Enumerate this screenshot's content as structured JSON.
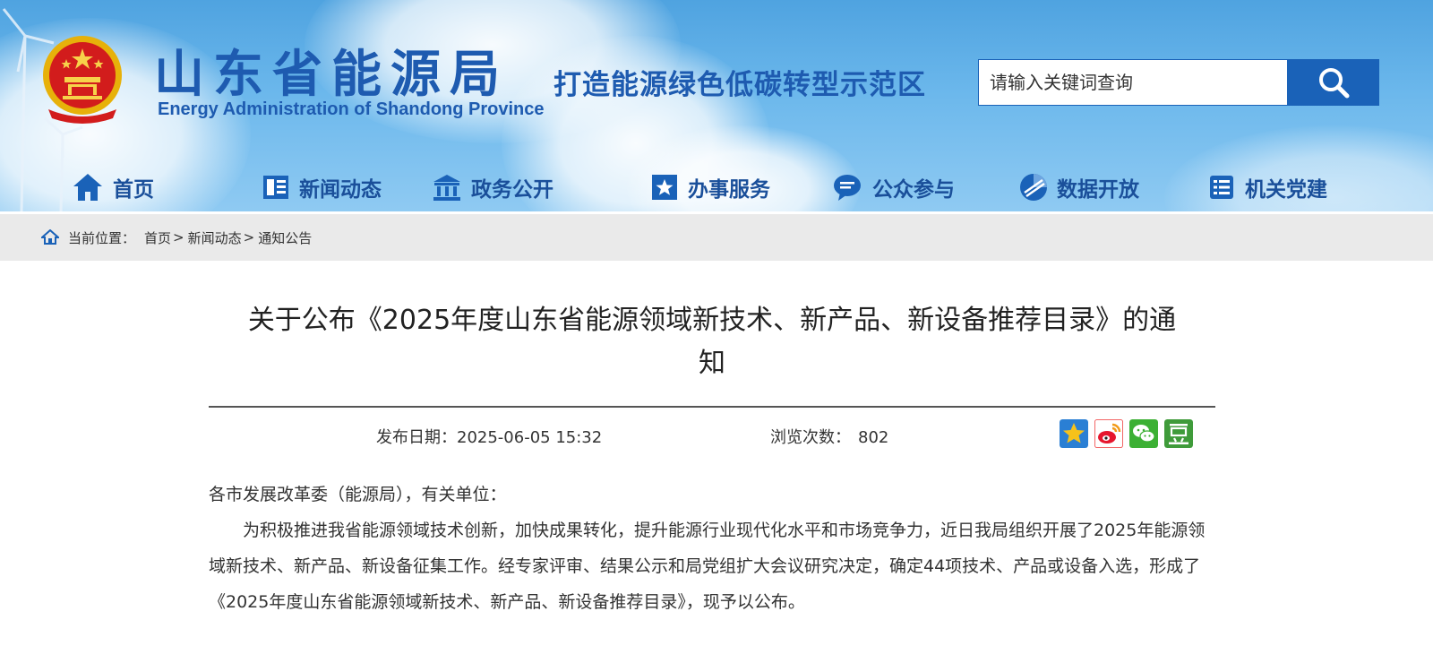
{
  "header": {
    "site_title": "山东省能源局",
    "site_title_en": "Energy Administration of Shandong Province",
    "slogan": "打造能源绿色低碳转型示范区",
    "search_placeholder": "请输入关键词查询",
    "search_icon": "search-icon"
  },
  "nav": [
    {
      "label": "首页",
      "icon": "home-icon"
    },
    {
      "label": "新闻动态",
      "icon": "news-icon"
    },
    {
      "label": "政务公开",
      "icon": "government-icon"
    },
    {
      "label": "办事服务",
      "icon": "service-icon"
    },
    {
      "label": "公众参与",
      "icon": "chat-icon"
    },
    {
      "label": "数据开放",
      "icon": "pie-chart-icon"
    },
    {
      "label": "机关党建",
      "icon": "party-building-icon"
    }
  ],
  "breadcrumb": {
    "prefix": "当前位置：",
    "items": [
      "首页",
      "新闻动态",
      "通知公告"
    ],
    "separator": ">"
  },
  "article": {
    "title_line1": "关于公布《2025年度山东省能源领域新技术、新产品、新设备推荐目录》的通",
    "title_line2": "知",
    "publish_label": "发布日期：",
    "publish_date": "2025-06-05 15:32",
    "views_label": "浏览次数：",
    "views": "802",
    "share_icons": [
      "favorite-icon",
      "weibo-icon",
      "wechat-icon",
      "douban-icon"
    ],
    "salutation": "各市发展改革委（能源局），有关单位：",
    "paragraph": "为积极推进我省能源领域技术创新，加快成果转化，提升能源行业现代化水平和市场竞争力，近日我局组织开展了2025年能源领域新技术、新产品、新设备征集工作。经专家评审、结果公示和局党组扩大会议研究决定，确定44项技术、产品或设备入选，形成了《2025年度山东省能源领域新技术、新产品、新设备推荐目录》，现予以公布。"
  },
  "colors": {
    "brand_blue": "#1a62b8",
    "title_blue": "#1e5bb0",
    "nav_text": "#1a4f9a",
    "breadcrumb_bg": "#eaeaea"
  }
}
